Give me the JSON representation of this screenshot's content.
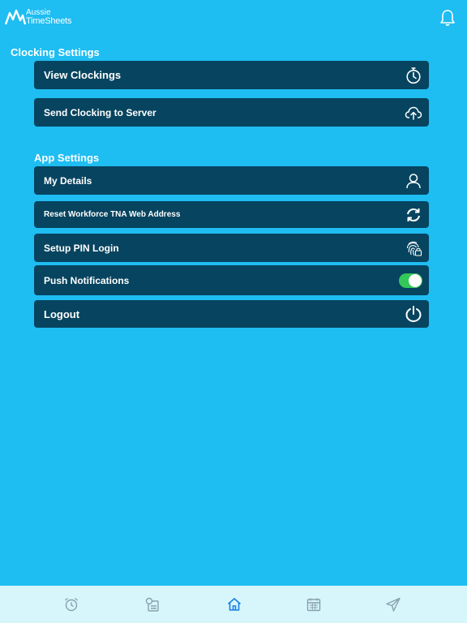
{
  "header": {
    "logo_line1": "Aussie",
    "logo_line2": "TimeSheets",
    "logo_icon": "mountain-logo",
    "notification_icon": "bell-icon"
  },
  "clocking_settings": {
    "title": "Clocking Settings",
    "items": [
      {
        "label": "View Clockings",
        "icon": "stopwatch-icon"
      },
      {
        "label": "Send Clocking to Server",
        "icon": "cloud-upload-icon"
      }
    ]
  },
  "app_settings": {
    "title": "App Settings",
    "items": [
      {
        "label": "My Details",
        "icon": "user-icon"
      },
      {
        "label": "Reset Workforce TNA Web Address",
        "icon": "sync-icon"
      },
      {
        "label": "Setup PIN Login",
        "icon": "fingerprint-icon"
      },
      {
        "label": "Push Notifications",
        "toggle_on": true
      },
      {
        "label": "Logout",
        "icon": "power-icon"
      }
    ]
  },
  "bottom_nav": {
    "tabs": [
      {
        "icon": "alarm-clock-icon",
        "active": false
      },
      {
        "icon": "timesheet-icon",
        "active": false
      },
      {
        "icon": "home-icon",
        "active": true
      },
      {
        "icon": "calendar-icon",
        "active": false
      },
      {
        "icon": "send-icon",
        "active": false
      }
    ],
    "active_color": "#1a7fe0",
    "inactive_color": "#8aa0ad"
  },
  "colors": {
    "background": "#1ebdf2",
    "row_background": "#07445f",
    "toggle_on": "#34c759",
    "bottom_bar": "#d6f6fb"
  }
}
